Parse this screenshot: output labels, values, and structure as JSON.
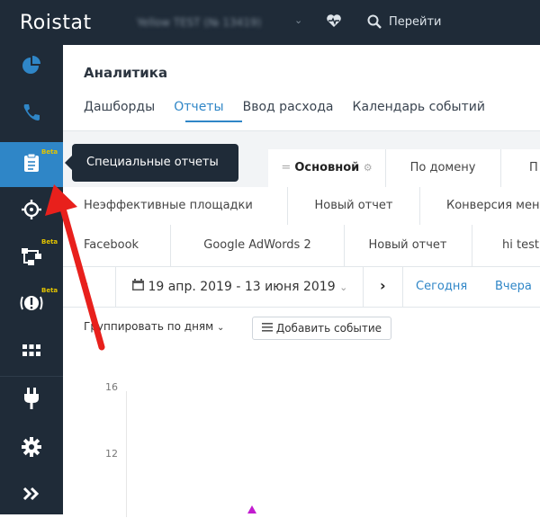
{
  "topbar": {
    "logo": "Roistat",
    "project": "Yellow TEST (№ 13419)",
    "goto_label": "Перейти"
  },
  "sidebar": {
    "items": [
      {
        "icon": "pie-chart-icon"
      },
      {
        "icon": "phone-icon"
      },
      {
        "icon": "clipboard-icon",
        "badge": "Beta"
      },
      {
        "icon": "crosshair-icon"
      },
      {
        "icon": "flow-icon",
        "badge": "Beta"
      },
      {
        "icon": "alert-icon",
        "badge": "Beta"
      },
      {
        "icon": "grid-icon"
      },
      {
        "icon": "plug-icon"
      },
      {
        "icon": "gear-icon"
      },
      {
        "icon": "double-chevron-right-icon"
      }
    ]
  },
  "page": {
    "title": "Аналитика",
    "tabs": [
      "Дашборды",
      "Отчеты",
      "Ввод расхода",
      "Календарь событий"
    ],
    "active_tab": "Отчеты"
  },
  "tooltip": "Специальные отчеты",
  "report_rows": [
    [
      "",
      "Основной",
      "По домену",
      "П"
    ],
    [
      "Неэффективные площадки",
      "Новый отчет",
      "Конверсия мен"
    ],
    [
      "Facebook",
      "Google AdWords 2",
      "Новый отчет",
      "hi test"
    ]
  ],
  "datebar": {
    "range": "19 апр. 2019 - 13 июня 2019",
    "today": "Сегодня",
    "yesterday": "Вчера"
  },
  "controls": {
    "group_by": "Группировать по дням",
    "add_event": "Добавить событие"
  },
  "chart_data": {
    "type": "line",
    "yticks": [
      "16",
      "12"
    ]
  },
  "colors": {
    "sidebar": "#1f2b38",
    "accent": "#2f86c7",
    "beta": "#e3c400",
    "arrow": "#e8201c"
  }
}
